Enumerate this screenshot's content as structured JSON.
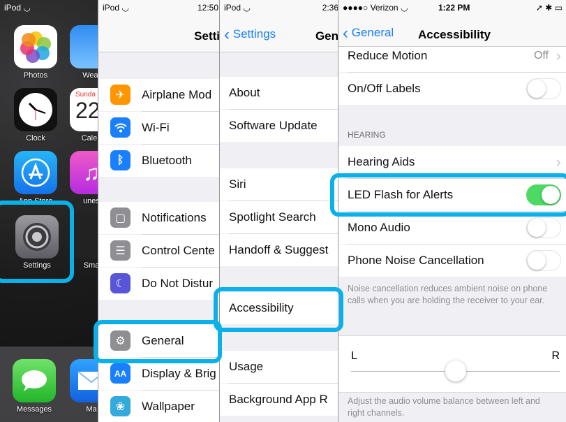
{
  "home": {
    "status_left": "iPod",
    "apps": [
      "Photos",
      "Weat",
      "Clock",
      "Calen",
      "App Store",
      "unes",
      "Settings",
      "Sma"
    ],
    "calendar_day": "Sunda",
    "calendar_date": "22",
    "dock": [
      "Messages",
      "Ma"
    ]
  },
  "settings": {
    "status_left": "iPod",
    "status_time": "12:50",
    "title": "Setti",
    "items": [
      "Airplane Mod",
      "Wi-Fi",
      "Bluetooth",
      "Notifications",
      "Control Cente",
      "Do Not Distur",
      "General",
      "Display & Brig",
      "Wallpaper"
    ]
  },
  "general": {
    "status_left": "iPod",
    "status_time": "2:36",
    "back_label": "Settings",
    "title": "Gen",
    "items": [
      "About",
      "Software Update",
      "Siri",
      "Spotlight Search",
      "Handoff & Suggest",
      "Accessibility",
      "Usage",
      "Background App R"
    ]
  },
  "accessibility": {
    "status_carrier": "Verizon",
    "status_time": "1:22 PM",
    "back_label": "General",
    "title": "Accessibility",
    "reduce_motion_label": "Reduce Motion",
    "reduce_motion_value": "Off",
    "onoff_labels": "On/Off Labels",
    "hearing_header": "HEARING",
    "hearing_aids": "Hearing Aids",
    "led_flash": "LED Flash for Alerts",
    "led_flash_on": true,
    "mono_audio": "Mono Audio",
    "noise_cancel": "Phone Noise Cancellation",
    "noise_note": "Noise cancellation reduces ambient noise on phone calls when you are holding the receiver to your ear.",
    "balance_left": "L",
    "balance_right": "R",
    "balance_value": 0.5,
    "balance_note": "Adjust the audio volume balance between left and right channels."
  },
  "colors": {
    "highlight": "#0ab0e8",
    "ios_blue": "#1a7ffb",
    "toggle_on": "#4cd964",
    "group_bg": "#efeff4"
  }
}
